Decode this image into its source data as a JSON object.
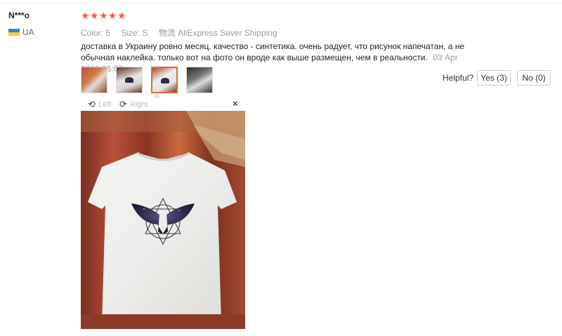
{
  "review": {
    "user_name": "N***o",
    "country": "UA",
    "rating": 5,
    "star_glyph": "★",
    "meta": {
      "color_label": "Color:",
      "color_value": "5",
      "size_label": "Size:",
      "size_value": "S",
      "shipping": "物流 AliExpress Saver Shipping"
    },
    "text": "доставка в Украину ровно месяц. качество - синтетика. очень радует, что рисунок напечатан, а не обычная наклейка. только вот на фото он вроде как выше размещен, чем в реальности.",
    "date": "03 Apr 2019 06:07",
    "helpful_label": "Helpful?",
    "yes_label": "Yes (3)",
    "no_label": "No (0)"
  },
  "viewer": {
    "left_label": "Left",
    "right_label": "Right",
    "close_glyph": "×",
    "rotate_left_icon": "rotate-left-icon",
    "rotate_right_icon": "rotate-right-icon"
  },
  "colors": {
    "star": "#f55a4e",
    "active_thumb_border": "#e46a2b"
  }
}
